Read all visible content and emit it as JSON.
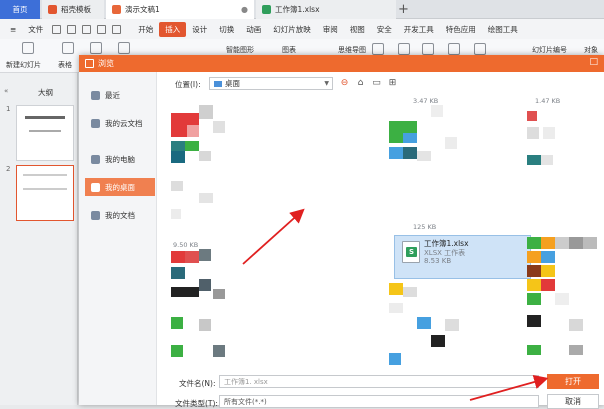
{
  "tabs": {
    "home": "首页",
    "template": "稻壳模板",
    "ppt": "演示文稿1",
    "xlsx": "工作簿1.xlsx"
  },
  "menu": {
    "file": "文件",
    "items": [
      "开始",
      "插入",
      "设计",
      "切换",
      "动画",
      "幻灯片放映",
      "审阅",
      "视图",
      "安全",
      "开发工具",
      "特色应用",
      "绘图工具"
    ]
  },
  "ribbon": {
    "new_slide": "新建幻灯片",
    "table": "表格",
    "smart_shape": "智能图形",
    "chart": "图表",
    "mindmap": "思维导图",
    "slide_number": "幻灯片编号",
    "object": "对象"
  },
  "leftpane": {
    "outline": "大纲",
    "slide_numbers": [
      "1",
      "2"
    ]
  },
  "dialog": {
    "title": "浏览",
    "sidebar": [
      "最近",
      "我的云文档",
      "我的电脑",
      "我的桌面",
      "我的文档"
    ],
    "location_label": "位置(I):",
    "location_value": "桌面",
    "selected_file": {
      "name": "工作簿1.xlsx",
      "type": "XLSX 工作表",
      "size": "8.53 KB"
    },
    "sizes": [
      "3.47 KB",
      "1.47 KB",
      "125 KB",
      "9.50 KB"
    ],
    "filename_label": "文件名(N):",
    "filename_value": "工作簿1. xlsx",
    "filetype_label": "文件类型(T):",
    "filetype_value": "所有文件(*.*)",
    "open": "打开",
    "cancel": "取消"
  },
  "colors": {
    "accent": "#ee6a2e",
    "home_tab": "#3d6fd8",
    "excel_green": "#2f9e5b"
  }
}
